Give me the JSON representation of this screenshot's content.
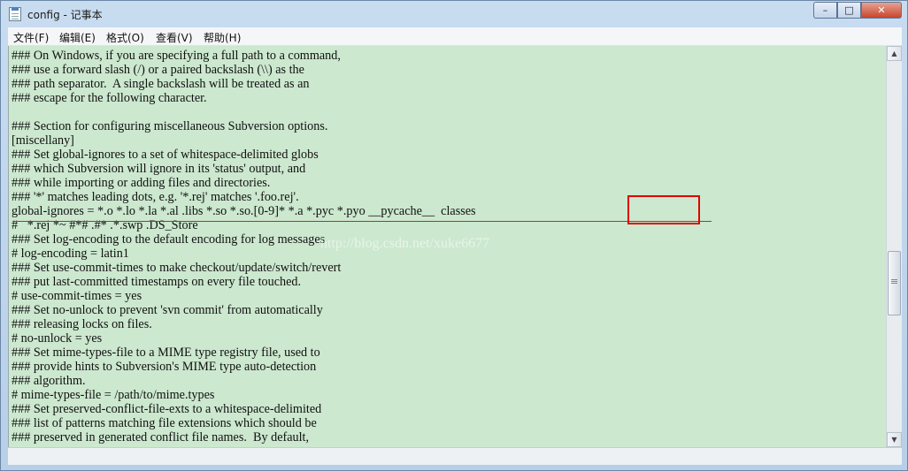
{
  "window": {
    "title": "config - 记事本",
    "controls": {
      "minimize": "–",
      "maximize": "□",
      "close": "✕"
    }
  },
  "menu": [
    {
      "label": "文件(F)"
    },
    {
      "label": "编辑(E)"
    },
    {
      "label": "格式(O)"
    },
    {
      "label": "查看(V)"
    },
    {
      "label": "帮助(H)"
    }
  ],
  "editor": {
    "lines": [
      "### On Windows, if you are specifying a full path to a command,",
      "### use a forward slash (/) or a paired backslash (\\\\) as the",
      "### path separator.  A single backslash will be treated as an",
      "### escape for the following character.",
      "",
      "### Section for configuring miscellaneous Subversion options.",
      "[miscellany]",
      "### Set global-ignores to a set of whitespace-delimited globs",
      "### which Subversion will ignore in its 'status' output, and",
      "### while importing or adding files and directories.",
      "### '*' matches leading dots, e.g. '*.rej' matches '.foo.rej'.",
      "global-ignores = *.o *.lo *.la *.al .libs *.so *.so.[0-9]* *.a *.pyc *.pyo __pycache__  classes",
      "#   *.rej *~ #*# .#* .*.swp .DS_Store",
      "### Set log-encoding to the default encoding for log messages",
      "# log-encoding = latin1",
      "### Set use-commit-times to make checkout/update/switch/revert",
      "### put last-committed timestamps on every file touched.",
      "# use-commit-times = yes",
      "### Set no-unlock to prevent 'svn commit' from automatically",
      "### releasing locks on files.",
      "# no-unlock = yes",
      "### Set mime-types-file to a MIME type registry file, used to",
      "### provide hints to Subversion's MIME type auto-detection",
      "### algorithm.",
      "# mime-types-file = /path/to/mime.types",
      "### Set preserved-conflict-file-exts to a whitespace-delimited",
      "### list of patterns matching file extensions which should be",
      "### preserved in generated conflict file names.  By default,"
    ],
    "watermark": "http://blog.csdn.net/xuke6677"
  },
  "colors": {
    "editor_bg": "#cce8cf",
    "highlight": "#e00000"
  }
}
